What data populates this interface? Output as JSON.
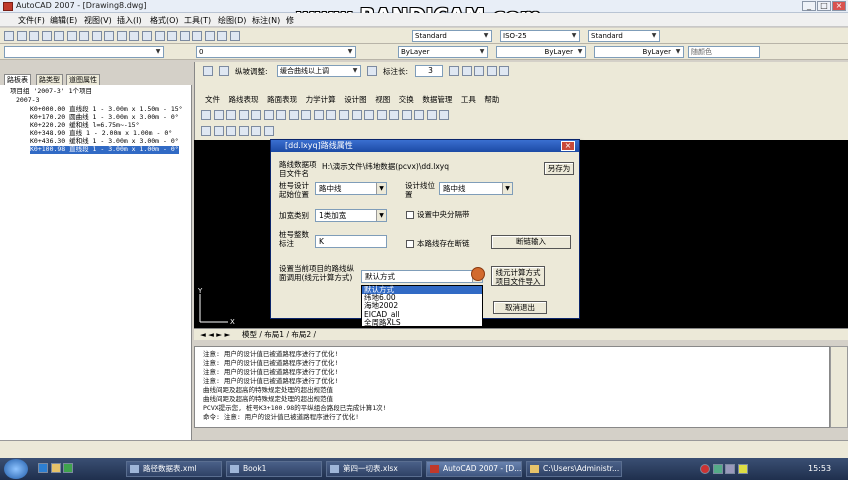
{
  "window": {
    "title": "AutoCAD 2007 - [Drawing8.dwg]",
    "min": "_",
    "max": "□",
    "close": "×"
  },
  "watermark": "www.BANDICAM.com",
  "menu": [
    "文件(F)",
    "编辑(E)",
    "视图(V)",
    "插入(I)",
    "格式(O)",
    "工具(T)",
    "绘图(D)",
    "标注(N)",
    "修"
  ],
  "toolbar1": {
    "text_style": "Standard",
    "dim_style": "ISO-25",
    "table_style": "Standard"
  },
  "toolbar2": {
    "layer": "0",
    "color": "ByLayer",
    "linetype": "ByLayer",
    "lineweight": "ByLayer",
    "plotstyle": "随颜色"
  },
  "toolbar3": {
    "label": "纵坡调整:",
    "mode": "缓合曲线以上调",
    "mark_label": "标注长:",
    "mark_value": "3"
  },
  "plugin_menu": [
    "文件",
    "路线表现",
    "路面表现",
    "力学计算",
    "设计图",
    "视图",
    "交换",
    "数据管理",
    "工具",
    "帮助"
  ],
  "left_tabs": [
    "路板表",
    "路类型",
    "道图属性"
  ],
  "tree": [
    "项目组 '2007-3' 1个项目",
    "2007-3",
    "K0+000.00 直线段 1 - 3.00m x 1.50m - 15°",
    "K0+170.20 圆曲线 1 - 3.00m x 3.00m - 0°",
    "K0+220.20 缓和线 l=6.75m~-15°",
    "K0+348.90 直线 1 - 2.00m x 1.00m - 0°",
    "K0+436.30 缓和线 1 - 3.00m x 3.00m - 0°",
    "K0+100.98 直线段 1 - 3.00m x 1.00m - 0°"
  ],
  "layout_tabs": "模型 / 布局1 / 布局2 /",
  "cmd_lines": [
    "注意: 用户的设计值已被道路程序进行了优化!",
    "注意: 用户的设计值已被道路程序进行了优化!",
    "注意: 用户的设计值已被道路程序进行了优化!",
    "注意: 用户的设计值已被道路程序进行了优化!",
    "曲线间距及超高的特殊规定处理的超出规范值",
    "曲线间距及超高的特殊规定处理的超出规范值",
    "PCVX提示您, 桩号K3+100.98的平纵组合路段已完成计算1次!",
    "命令: 注意: 用户的设计值已被道路程序进行了优化!"
  ],
  "dialog": {
    "title": "[dd.lxyq]路线属性",
    "path_label": "路线数据项目文件名",
    "path_value": "H:\\演示文件\\纬地数据(pcvx)\\dd.lxyq",
    "saveas": "另存为",
    "station_label": "桩号设计起始位置",
    "station_value": "路中线",
    "design_label": "设计线位置",
    "design_value": "路中线",
    "widen_label": "加宽类别",
    "widen_value": "1类加宽",
    "central_div": "设置中央分隔带",
    "chainage_label": "桩号整数标注",
    "chainage_value": "K",
    "pre_design": "本路线存在断链",
    "chain_input_btn": "断链输入",
    "method_label": "设置当前项目的路线纵面调用(线元计算方式)",
    "method_value": "默认方式",
    "calc_btn": "线元计算方式项目文件导入",
    "cancel_btn": "取消退出",
    "options": [
      "默认方式",
      "纬地6.00",
      "海地2002",
      "EICAD_all",
      "全周路XLS"
    ]
  },
  "taskbar": {
    "tasks": [
      "路径数据表.xml",
      "Book1",
      "第四一切表.xlsx",
      "AutoCAD 2007 - [D...",
      "C:\\Users\\Administr..."
    ],
    "clock": "15:53"
  }
}
